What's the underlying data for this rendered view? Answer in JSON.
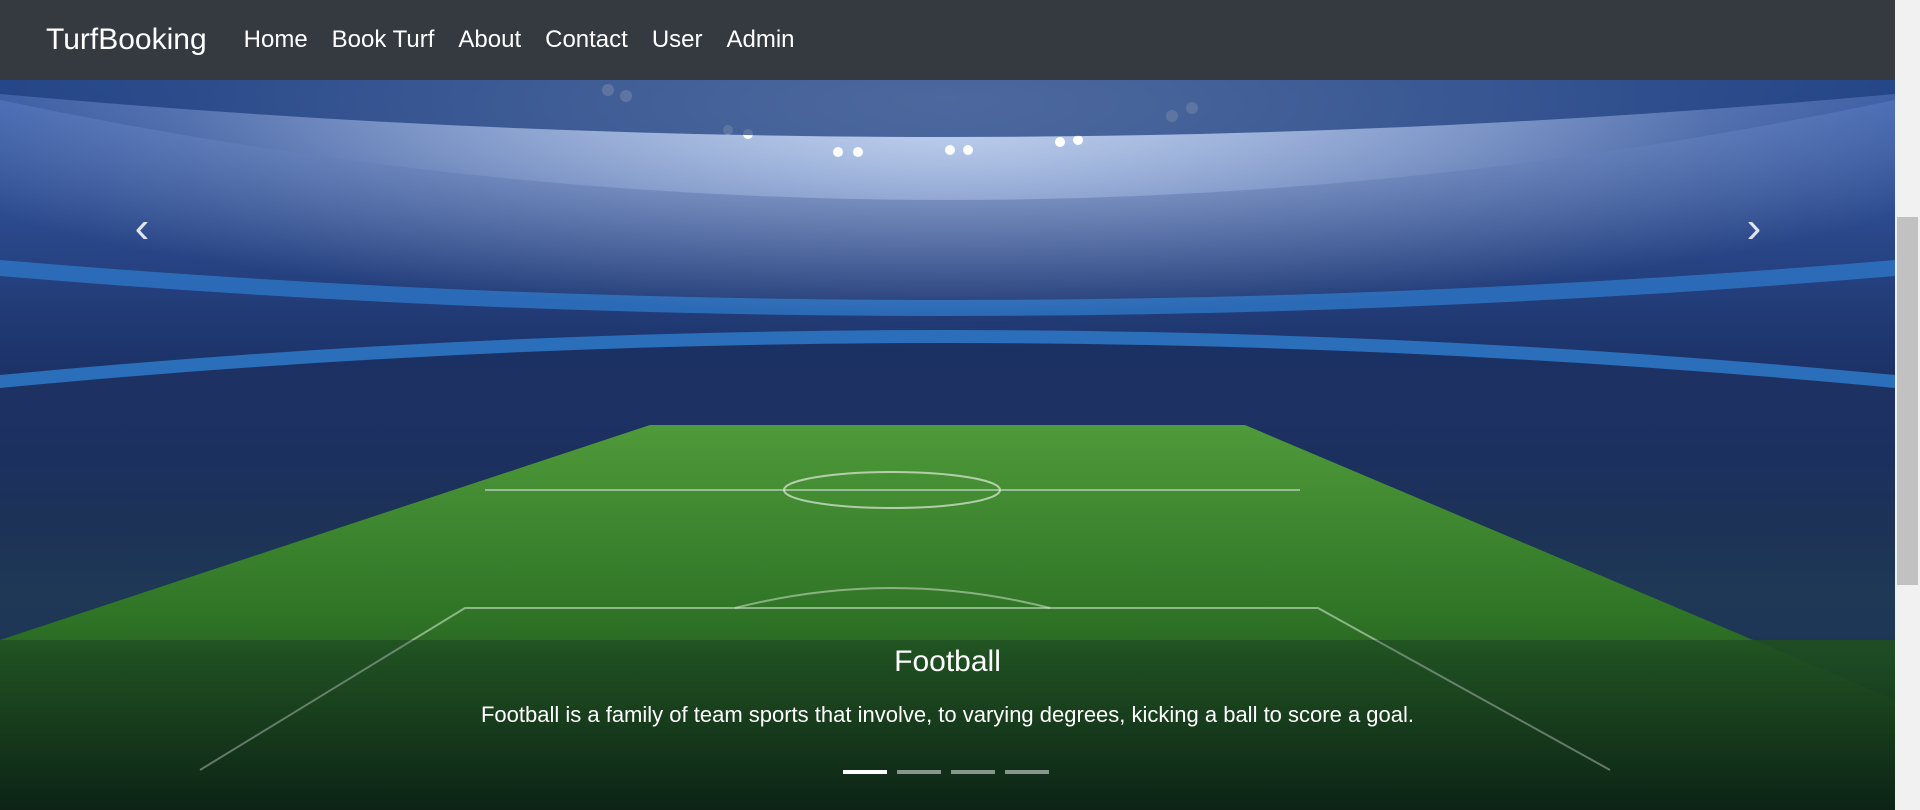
{
  "navbar": {
    "brand": "TurfBooking",
    "links": [
      {
        "label": "Home"
      },
      {
        "label": "Book Turf"
      },
      {
        "label": "About"
      },
      {
        "label": "Contact"
      },
      {
        "label": "User"
      },
      {
        "label": "Admin"
      }
    ]
  },
  "carousel": {
    "caption_title": "Football",
    "caption_text": "Football is a family of team sports that involve, to varying degrees, kicking a ball to score a goal.",
    "prev_icon": "chevron-left-icon",
    "next_icon": "chevron-right-icon",
    "prev_glyph": "‹",
    "next_glyph": "›",
    "slide_count": 4,
    "active_slide": 1
  },
  "colors": {
    "navbar_bg": "#343a40",
    "text": "#ffffff"
  }
}
